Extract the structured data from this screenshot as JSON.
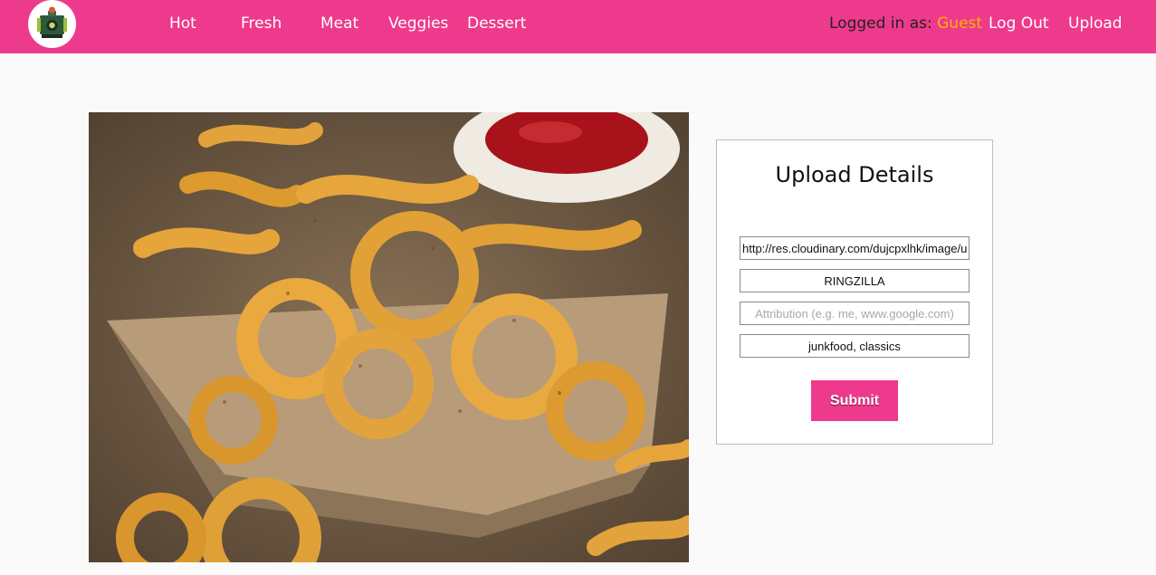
{
  "brand": {
    "logo_icon": "camera-logo-icon"
  },
  "nav": {
    "links": [
      "Hot",
      "Fresh",
      "Meat",
      "Veggies",
      "Dessert"
    ],
    "login_prefix": "Logged in as: ",
    "user": "Guest",
    "logout": "Log Out",
    "upload": "Upload"
  },
  "hero": {
    "image": "curly-fries-photo"
  },
  "form": {
    "title": "Upload Details",
    "url_value": "http://res.cloudinary.com/dujcpxlhk/image/u",
    "name_value": "RINGZILLA",
    "attribution_value": "",
    "attribution_placeholder": "Attribution (e.g. me, www.google.com)",
    "tags_value": "junkfood, classics",
    "submit_label": "Submit"
  },
  "colors": {
    "brand_pink": "#ee3a8c",
    "user_highlight": "#ffb300",
    "panel_border": "#c8bba8"
  }
}
